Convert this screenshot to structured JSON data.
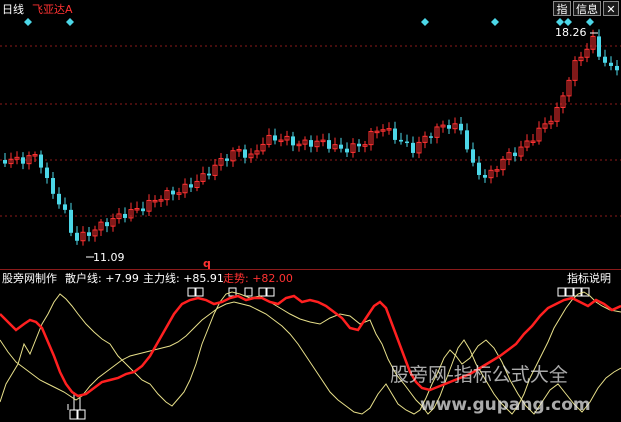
{
  "header": {
    "period_label": "日线",
    "stock_name": "飞亚达A",
    "btn_indicator": "指",
    "btn_info": "信息",
    "btn_close": "✕"
  },
  "price_panel": {
    "high_label": "18.26",
    "low_label": "11.09",
    "q_mark": "q"
  },
  "indicator_panel": {
    "name": "股旁网制作",
    "retail_label": "散户线: +7.99",
    "main_label": "主力线: +85.91",
    "trend_label": "走势: +82.00",
    "help_button": "指标说明"
  },
  "watermark": {
    "line1": "股旁网-指标公式大全",
    "line2": "www.gupang.com"
  },
  "colors": {
    "background": "#000000",
    "up": "#ff3232",
    "down": "#4cd7e8",
    "main_line": "#ff2020",
    "aux_line": "#e8e08a",
    "grid": "#8b1a1a"
  }
}
